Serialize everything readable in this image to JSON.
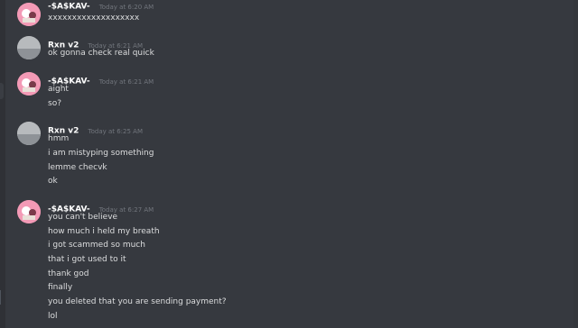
{
  "messages": [
    {
      "username": "-$A$KAV-",
      "timestamp": "Today at 6:20 AM",
      "avatar": "pink",
      "lines": [
        "xxxxxxxxxxxxxxxxxxx"
      ]
    },
    {
      "username": "Rxn v2",
      "timestamp": "Today at 6:21 AM",
      "avatar": "gray",
      "lines": [
        "ok gonna check real quick"
      ]
    },
    {
      "username": "-$A$KAV-",
      "timestamp": "Today at 6:21 AM",
      "avatar": "pink",
      "lines": [
        "aight",
        "so?"
      ]
    },
    {
      "username": "Rxn v2",
      "timestamp": "Today at 6:25 AM",
      "avatar": "gray",
      "lines": [
        "hmm",
        "i am mistyping something",
        "lemme checvk",
        "ok"
      ]
    },
    {
      "username": "-$A$KAV-",
      "timestamp": "Today at 6:27 AM",
      "avatar": "pink",
      "lines": [
        "you can't believe",
        "how much i held my breath",
        "i got scammed so much",
        "that i got used to it",
        "thank god",
        "finally",
        "you deleted that you are sending payment?",
        "lol"
      ]
    }
  ],
  "colors": {
    "background": "#36393f",
    "username": "#ffffff",
    "timestamp": "#72767d",
    "text": "#dcddde",
    "avatar_pink": "#f39ab6",
    "avatar_gray": "#b7babd"
  }
}
